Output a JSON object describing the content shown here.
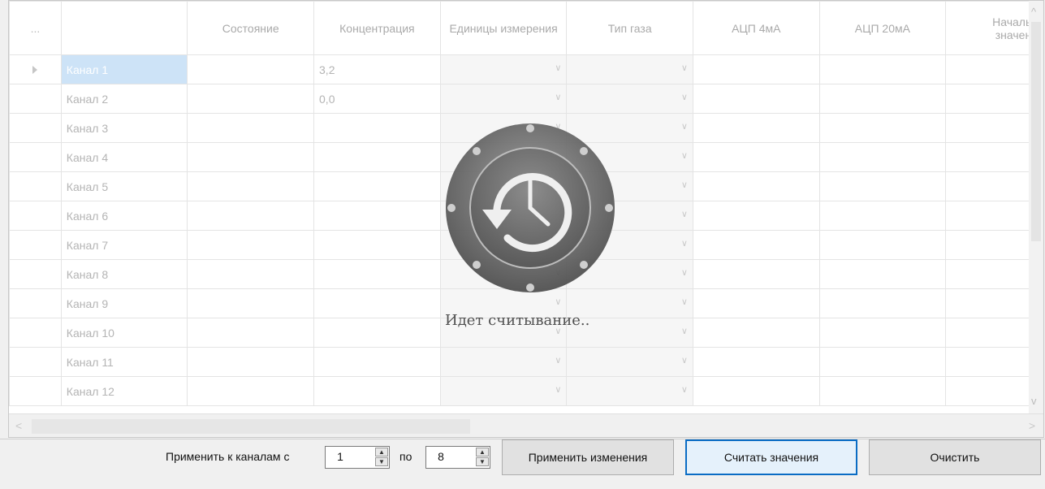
{
  "grid": {
    "corner": "...",
    "columns": [
      {
        "label": ""
      },
      {
        "label": "Состояние"
      },
      {
        "label": "Концентрация"
      },
      {
        "label": "Единицы измерения"
      },
      {
        "label": "Тип газа"
      },
      {
        "label": "АЦП 4мА"
      },
      {
        "label": "АЦП 20мА"
      },
      {
        "label": "Начальн значени"
      }
    ],
    "rows": [
      {
        "name": "Канал 1",
        "concentration": "3,2"
      },
      {
        "name": "Канал 2",
        "concentration": "0,0"
      },
      {
        "name": "Канал 3",
        "concentration": ""
      },
      {
        "name": "Канал 4",
        "concentration": ""
      },
      {
        "name": "Канал 5",
        "concentration": ""
      },
      {
        "name": "Канал 6",
        "concentration": ""
      },
      {
        "name": "Канал 7",
        "concentration": ""
      },
      {
        "name": "Канал 8",
        "concentration": ""
      },
      {
        "name": "Канал 9",
        "concentration": ""
      },
      {
        "name": "Канал 10",
        "concentration": ""
      },
      {
        "name": "Канал 11",
        "concentration": ""
      },
      {
        "name": "Канал 12",
        "concentration": ""
      }
    ],
    "selected_row": "Канал 1"
  },
  "loader": {
    "text": "Идет считывание..",
    "icon": "history-clock-icon"
  },
  "panel": {
    "apply_range_label": "Применить к каналам с",
    "from_value": "1",
    "to_label": "по",
    "to_value": "8",
    "apply_button": "Применить изменения",
    "read_button": "Считать значения",
    "clear_button": "Очистить"
  },
  "colors": {
    "selection": "#cde3f7",
    "focus_border": "#0a6cc4"
  }
}
